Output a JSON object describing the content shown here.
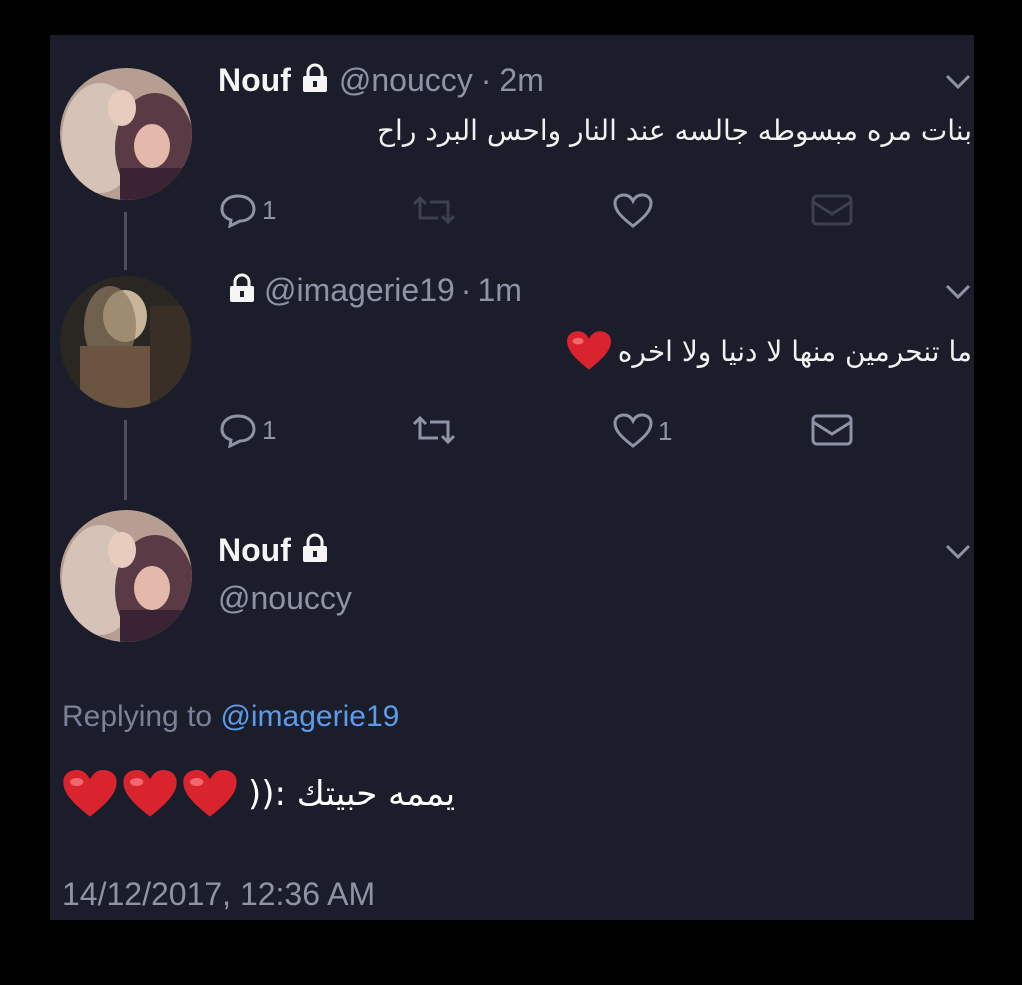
{
  "tweet1": {
    "name": "Nouf",
    "handle": "@nouccy",
    "time": "2m",
    "text": "بنات مره مبسوطه جالسه عند النار واحس البرد راح",
    "reply_count": "1",
    "like_count": "",
    "retweet_count": ""
  },
  "tweet2": {
    "handle": "@imagerie19",
    "time": "1m",
    "text": "ما تنحرمين منها لا دنيا ولا اخره",
    "reply_count": "1",
    "like_count": "1"
  },
  "tweet3": {
    "name": "Nouf",
    "handle": "@nouccy",
    "replying_prefix": "Replying to",
    "replying_handle": "@imagerie19",
    "text": "يممه حبيتك :((",
    "timestamp": "14/12/2017, 12:36 AM"
  },
  "colors": {
    "background": "#1b1d2b",
    "accent_link": "#5b9be8",
    "muted": "#8e94a6",
    "heart": "#d9232d"
  },
  "icons": [
    "lock-icon",
    "chevron-down-icon",
    "reply-icon",
    "retweet-icon",
    "heart-icon",
    "message-icon"
  ]
}
